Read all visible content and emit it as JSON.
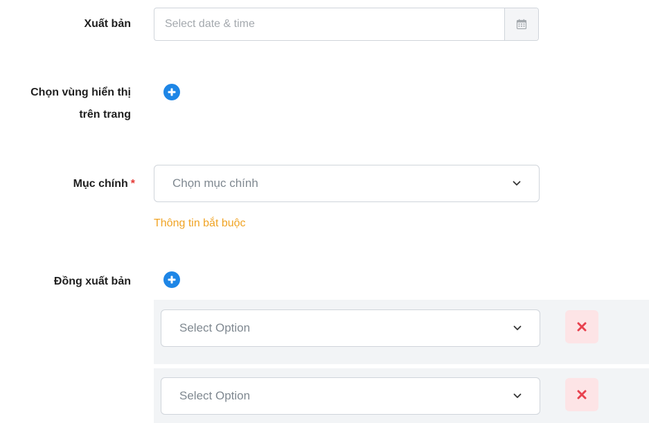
{
  "publish": {
    "label": "Xuất bản",
    "placeholder": "Select date & time",
    "icon": "calendar-icon"
  },
  "display_area": {
    "label_line1": "Chọn vùng hiển thị",
    "label_line2": "trên trang",
    "add_icon": "plus-circle-icon"
  },
  "main_category": {
    "label": "Mục chính",
    "required_mark": "*",
    "placeholder": "Chọn mục chính",
    "hint": "Thông tin bắt buộc"
  },
  "co_publish": {
    "label": "Đồng xuất bản",
    "add_icon": "plus-circle-icon",
    "rows": [
      {
        "placeholder": "Select Option"
      },
      {
        "placeholder": "Select Option"
      }
    ]
  },
  "colors": {
    "accent": "#1e86e6",
    "required": "#e53935",
    "hint": "#f0a323",
    "delete": "#e8414e",
    "delete_bg": "#fde4e6"
  }
}
